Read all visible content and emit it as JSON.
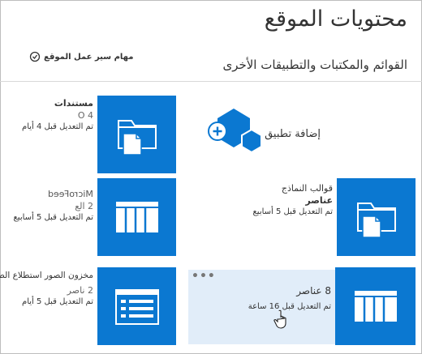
{
  "header": {
    "title": "محتويات الموقع",
    "site_workflows_label": "مهام سير عمل الموقع",
    "section_title": "القوائم والمكتبات والتطبيقات الأخرى"
  },
  "add_app": {
    "label": "إضافة تطبيق"
  },
  "tiles": {
    "documents": {
      "name": "مستندات",
      "count": "4 O",
      "modified": "تم التعديل قبل 4 أيام"
    },
    "microfeed": {
      "name": "MicroFeed",
      "count": "2 الع",
      "modified": "تم التعديل قبل 5 أسابيع"
    },
    "form_templates": {
      "name": "قوالب النماذج",
      "count": "عناصر",
      "modified": "تم التعديل قبل 5 أسابيع"
    },
    "picture_library": {
      "name": "مخزون الصور استطلاع الصور",
      "count": "2 ناصر",
      "modified": "تم التعديل قبل 5 أيام"
    },
    "survey": {
      "name": "8 عناصر",
      "modified": "تم التعديل قبل 16 ساعة"
    }
  },
  "ellipsis": "•••",
  "colors": {
    "tile_blue": "#0b78d1",
    "hover_bg": "#e1edf9",
    "hexagon_blue": "#0b78d1"
  },
  "icons": {
    "workflow": "workflow-icon",
    "add_app": "add-app-hexagon-icon",
    "folder_doc": "folder-document-icon",
    "list": "list-icon",
    "picture": "picture-library-icon",
    "cursor": "hand-cursor-icon"
  }
}
